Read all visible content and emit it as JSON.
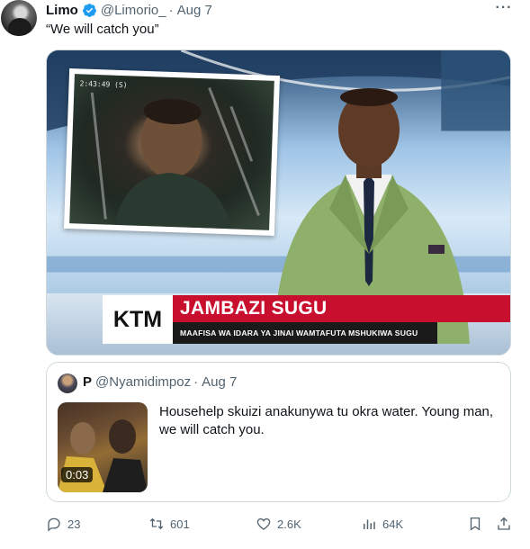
{
  "tweet": {
    "author_name": "Limo",
    "handle": "@Limorio_",
    "separator": "·",
    "date": "Aug 7",
    "text": "“We will catch you”",
    "more_label": "···"
  },
  "media": {
    "inset_timestamp": "2:43:49 (S)",
    "channel_logo": "KTM",
    "headline": "JAMBAZI SUGU",
    "subheadline": "MAAFISA WA IDARA YA JINAI WAMTAFUTA MSHUKIWA SUGU"
  },
  "quoted_tweet": {
    "author_name": "P",
    "handle": "@Nyamidimpoz",
    "separator": "·",
    "date": "Aug 7",
    "text": "Househelp skuizi anakunywa tu okra water. Young man, we will catch you.",
    "video_duration": "0:03"
  },
  "actions": {
    "replies": "23",
    "retweets": "601",
    "likes": "2.6K",
    "views": "64K"
  },
  "colors": {
    "verified_blue": "#1d9bf0",
    "headline_red": "#c8102e",
    "secondary_text": "#536471"
  }
}
